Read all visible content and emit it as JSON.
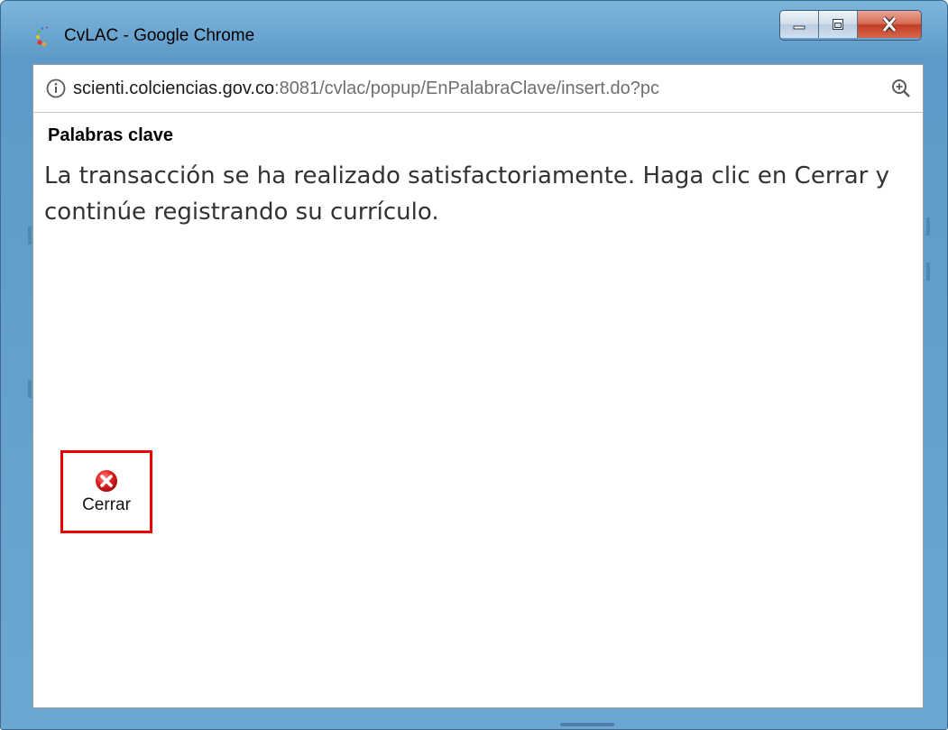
{
  "window": {
    "title": "CvLAC - Google Chrome",
    "frame_color": "#6ba7d0",
    "close_button_color": "#c23c22"
  },
  "address_bar": {
    "url_host": "scienti.colciencias.gov.co",
    "url_path": ":8081/cvlac/popup/EnPalabraClave/insert.do?pc",
    "left_icon": "info-icon",
    "right_icon": "zoom-icon"
  },
  "page": {
    "title": "Palabras clave",
    "message": "La transacción se ha realizado satisfactoriamente. Haga clic en Cerrar y continúe registrando su currículo.",
    "close_button": {
      "label": "Cerrar",
      "icon": "close-x-icon",
      "highlight_color": "#ee0000"
    }
  }
}
